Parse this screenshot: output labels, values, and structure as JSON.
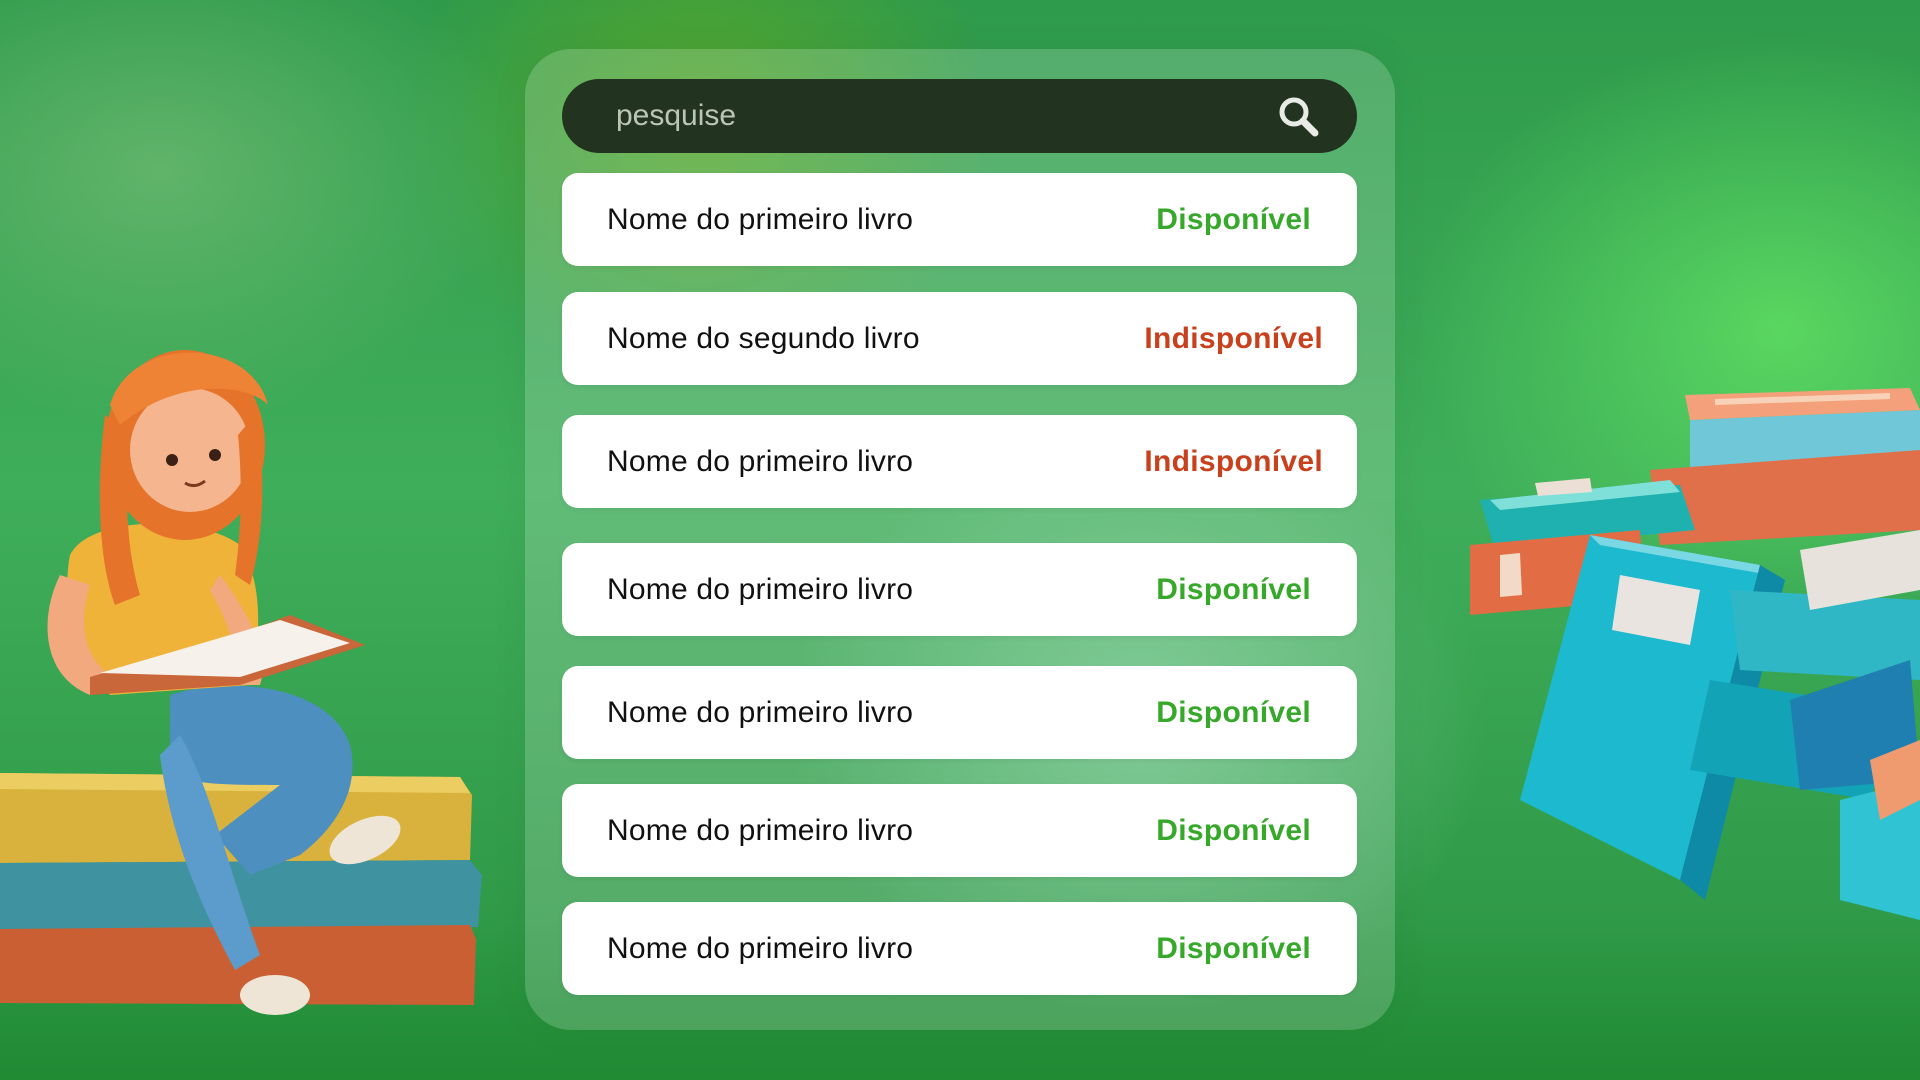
{
  "search": {
    "placeholder": "pesquise",
    "icon": "search-icon"
  },
  "books": [
    {
      "name": "Nome do primeiro livro",
      "status": "Disponível",
      "available": true
    },
    {
      "name": "Nome do segundo livro",
      "status": "Indisponível",
      "available": false
    },
    {
      "name": "Nome do primeiro livro",
      "status": "Indisponível",
      "available": false
    },
    {
      "name": "Nome do primeiro livro",
      "status": "Disponível",
      "available": true
    },
    {
      "name": "Nome do primeiro livro",
      "status": "Disponível",
      "available": true
    },
    {
      "name": "Nome do primeiro livro",
      "status": "Disponível",
      "available": true
    },
    {
      "name": "Nome do primeiro livro",
      "status": "Disponível",
      "available": true
    }
  ],
  "colors": {
    "available": "#36a82a",
    "unavailable": "#c8401c",
    "search_bar": "#22331f"
  }
}
